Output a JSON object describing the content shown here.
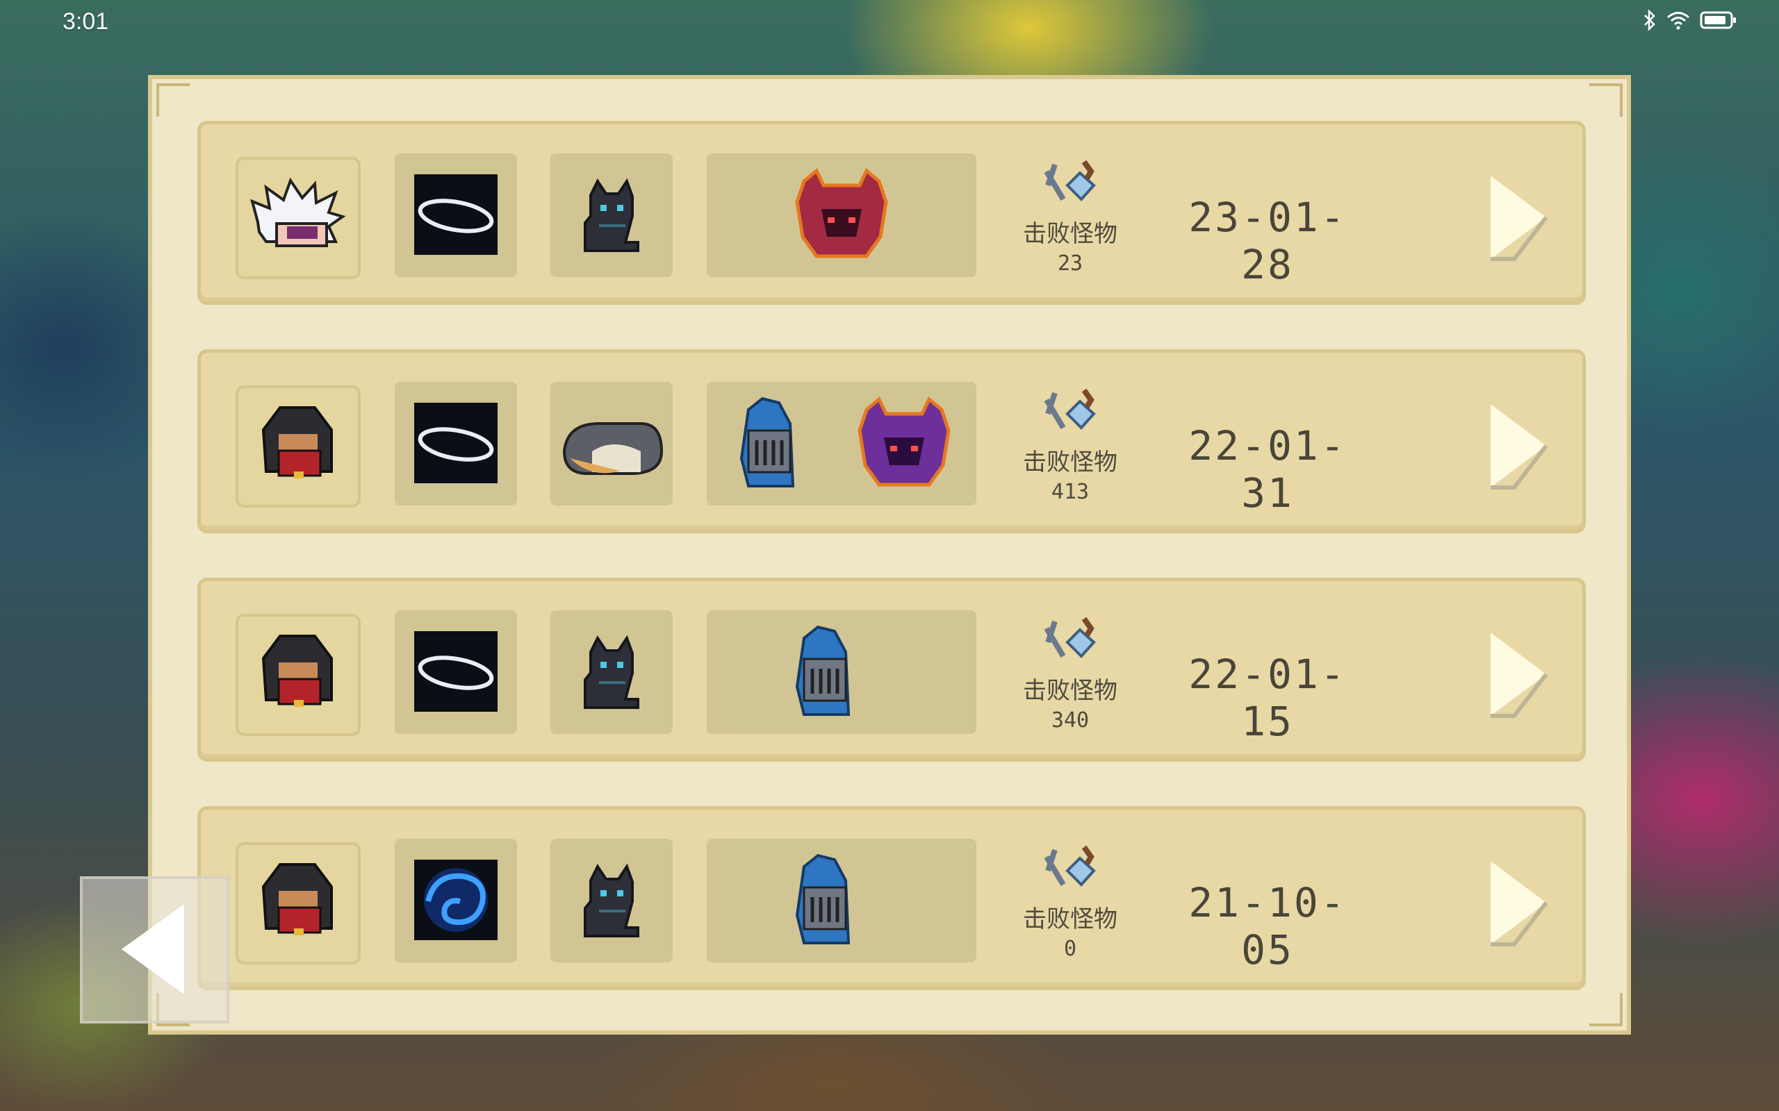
{
  "status_bar": {
    "time": "3:01",
    "icons": [
      "bluetooth-icon",
      "wifi-icon",
      "battery-icon"
    ]
  },
  "records": [
    {
      "hero": "white-haired-hero",
      "weapon": "dark-blade",
      "pet": "black-cat",
      "bosses": [
        "red-horned-helmet"
      ],
      "stat_label": "击败怪物",
      "kills": "23",
      "date": "23-01-28"
    },
    {
      "hero": "hooded-rogue",
      "weapon": "dark-blade",
      "pet": "gray-cat",
      "bosses": [
        "blue-knight-helmet",
        "purple-horned-helmet"
      ],
      "stat_label": "击败怪物",
      "kills": "413",
      "date": "22-01-31"
    },
    {
      "hero": "hooded-rogue",
      "weapon": "dark-blade",
      "pet": "black-cat",
      "bosses": [
        "blue-knight-helmet"
      ],
      "stat_label": "击败怪物",
      "kills": "340",
      "date": "22-01-15"
    },
    {
      "hero": "hooded-rogue",
      "weapon": "blue-swirl-orb",
      "pet": "black-cat",
      "bosses": [
        "blue-knight-helmet"
      ],
      "stat_label": "击败怪物",
      "kills": "0",
      "date": "21-10-05"
    }
  ],
  "colors": {
    "panel": "#f0e6c8",
    "row": "#e7d8a6",
    "slot": "#d2c594",
    "text": "#4a4538"
  }
}
